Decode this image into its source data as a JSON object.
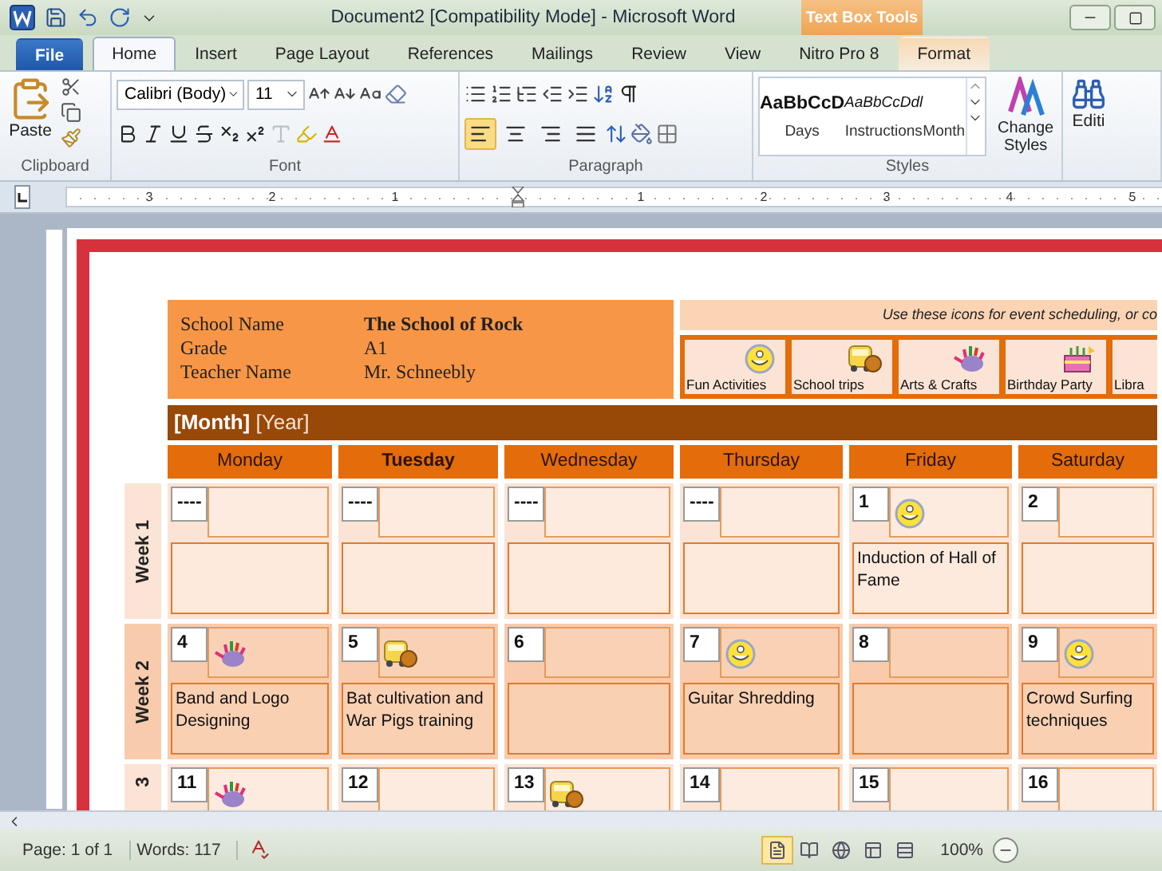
{
  "title_bar": {
    "title": "Document2 [Compatibility Mode] - Microsoft Word",
    "context_label": "Text Box Tools"
  },
  "tabs": [
    {
      "label": "File",
      "kind": "file",
      "selected": false
    },
    {
      "label": "Home",
      "kind": "normal",
      "selected": true
    },
    {
      "label": "Insert",
      "kind": "normal",
      "selected": false
    },
    {
      "label": "Page Layout",
      "kind": "normal",
      "selected": false
    },
    {
      "label": "References",
      "kind": "normal",
      "selected": false
    },
    {
      "label": "Mailings",
      "kind": "normal",
      "selected": false
    },
    {
      "label": "Review",
      "kind": "normal",
      "selected": false
    },
    {
      "label": "View",
      "kind": "normal",
      "selected": false
    },
    {
      "label": "Nitro Pro 8",
      "kind": "normal",
      "selected": false
    },
    {
      "label": "Format",
      "kind": "context",
      "selected": false
    }
  ],
  "ribbon": {
    "clipboard": {
      "paste": "Paste",
      "label": "Clipboard"
    },
    "font": {
      "name": "Calibri (Body)",
      "size": "11",
      "label": "Font"
    },
    "paragraph": {
      "label": "Paragraph",
      "alignment": [
        {
          "selected": true
        },
        {
          "selected": false
        },
        {
          "selected": false
        },
        {
          "selected": false
        }
      ]
    },
    "styles": {
      "label": "Styles",
      "items": [
        {
          "sample": "AaBbCcD",
          "name": "Days",
          "kind": "bold"
        },
        {
          "sample": "AaBbCcDdl",
          "name": "Instructions",
          "kind": "italic"
        },
        {
          "name": "Month",
          "kind": "plain"
        }
      ]
    },
    "change_styles": "Change Styles",
    "editing": "Editi"
  },
  "ruler": {
    "left_labels": [
      "3",
      "2",
      "1"
    ],
    "right_labels": [
      "1",
      "2",
      "3",
      "4",
      "5"
    ]
  },
  "calendar": {
    "school": [
      {
        "label": "School Name",
        "value": "The School of Rock"
      },
      {
        "label": "Grade",
        "value": "A1"
      },
      {
        "label": "Teacher Name",
        "value": "Mr. Schneebly"
      }
    ],
    "legend_note": "Use these icons for event scheduling, or co",
    "legend": [
      {
        "label": "Fun Activities",
        "kind": "fun"
      },
      {
        "label": "School trips",
        "kind": "trip"
      },
      {
        "label": "Arts & Crafts",
        "kind": "arts"
      },
      {
        "label": "Birthday Party",
        "kind": "party"
      },
      {
        "label": "Libra",
        "kind": "none"
      }
    ],
    "month_title": "**[Month]** [Year]",
    "days": [
      {
        "label": "Monday",
        "bold": false
      },
      {
        "label": "Tuesday",
        "bold": true
      },
      {
        "label": "Wednesday",
        "bold": false
      },
      {
        "label": "Thursday",
        "bold": false
      },
      {
        "label": "Friday",
        "bold": false
      },
      {
        "label": "Saturday",
        "bold": false
      }
    ],
    "weeks": [
      {
        "label": "Week 1",
        "days": [
          {
            "date": "----"
          },
          {
            "date": "----"
          },
          {
            "date": "----"
          },
          {
            "date": "----"
          },
          {
            "date": "1",
            "kind": "fun",
            "event": "Induction of Hall of Fame"
          },
          {
            "date": "2"
          }
        ]
      },
      {
        "label": "Week 2",
        "days": [
          {
            "date": "4",
            "kind": "arts",
            "event": "Band and Logo Designing"
          },
          {
            "date": "5",
            "kind": "trip",
            "event": "Bat cultivation and War Pigs training"
          },
          {
            "date": "6"
          },
          {
            "date": "7",
            "kind": "fun",
            "event": "Guitar Shredding"
          },
          {
            "date": "8"
          },
          {
            "date": "9",
            "kind": "fun",
            "event": "Crowd Surfing techniques"
          }
        ]
      },
      {
        "label": "3",
        "days": [
          {
            "date": "11",
            "kind": "arts"
          },
          {
            "date": "12"
          },
          {
            "date": "13",
            "kind": "trip"
          },
          {
            "date": "14"
          },
          {
            "date": "15"
          },
          {
            "date": "16"
          }
        ]
      }
    ]
  },
  "status_bar": {
    "page": "Page: 1 of 1",
    "words": "Words: 117",
    "zoom": "100%",
    "views": [
      {
        "selected": true
      },
      {
        "selected": false
      },
      {
        "selected": false
      },
      {
        "selected": false
      },
      {
        "selected": false
      }
    ]
  }
}
